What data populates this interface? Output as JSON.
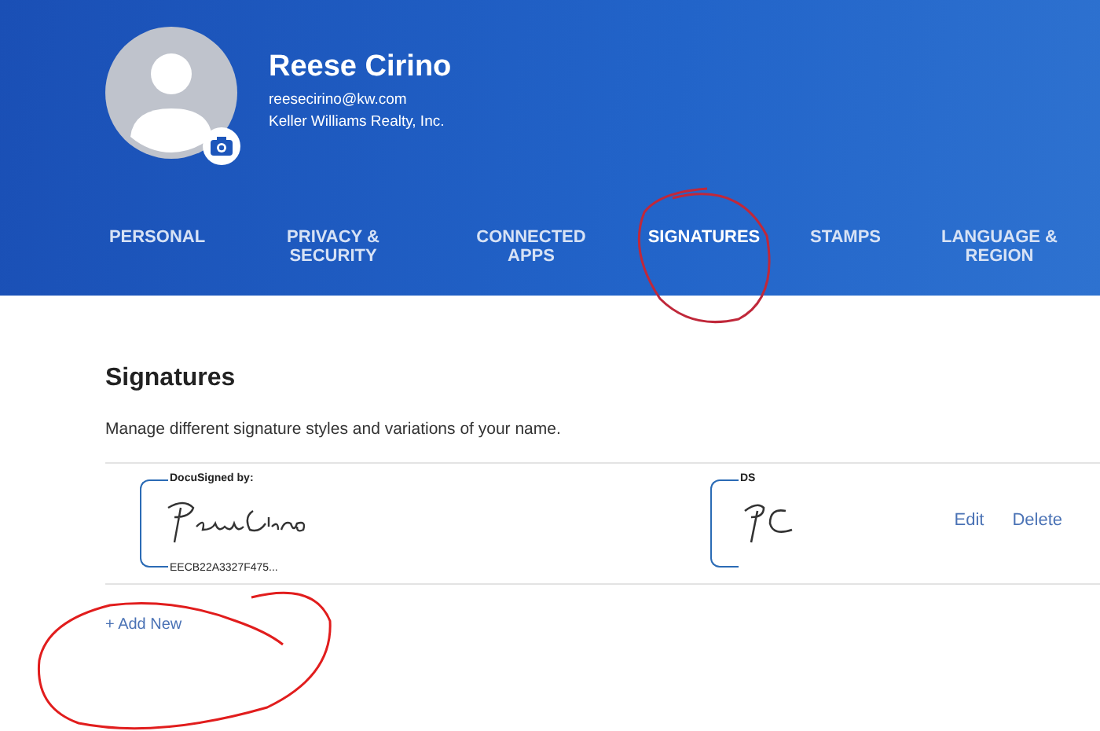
{
  "profile": {
    "name": "Reese Cirino",
    "email": "reesecirino@kw.com",
    "company": "Keller Williams Realty, Inc."
  },
  "tabs": [
    {
      "label": "PERSONAL",
      "selected": false
    },
    {
      "label": "PRIVACY & SECURITY",
      "selected": false
    },
    {
      "label": "CONNECTED APPS",
      "selected": false
    },
    {
      "label": "SIGNATURES",
      "selected": true
    },
    {
      "label": "STAMPS",
      "selected": false
    },
    {
      "label": "LANGUAGE & REGION",
      "selected": false
    }
  ],
  "section": {
    "title": "Signatures",
    "description": "Manage different signature styles and variations of your name."
  },
  "signature": {
    "signature_caption": "DocuSigned by:",
    "signature_code": "EECB22A3327F475...",
    "initials_caption": "DS",
    "actions": [
      "Edit",
      "Delete"
    ]
  },
  "add_new": "+ Add New"
}
